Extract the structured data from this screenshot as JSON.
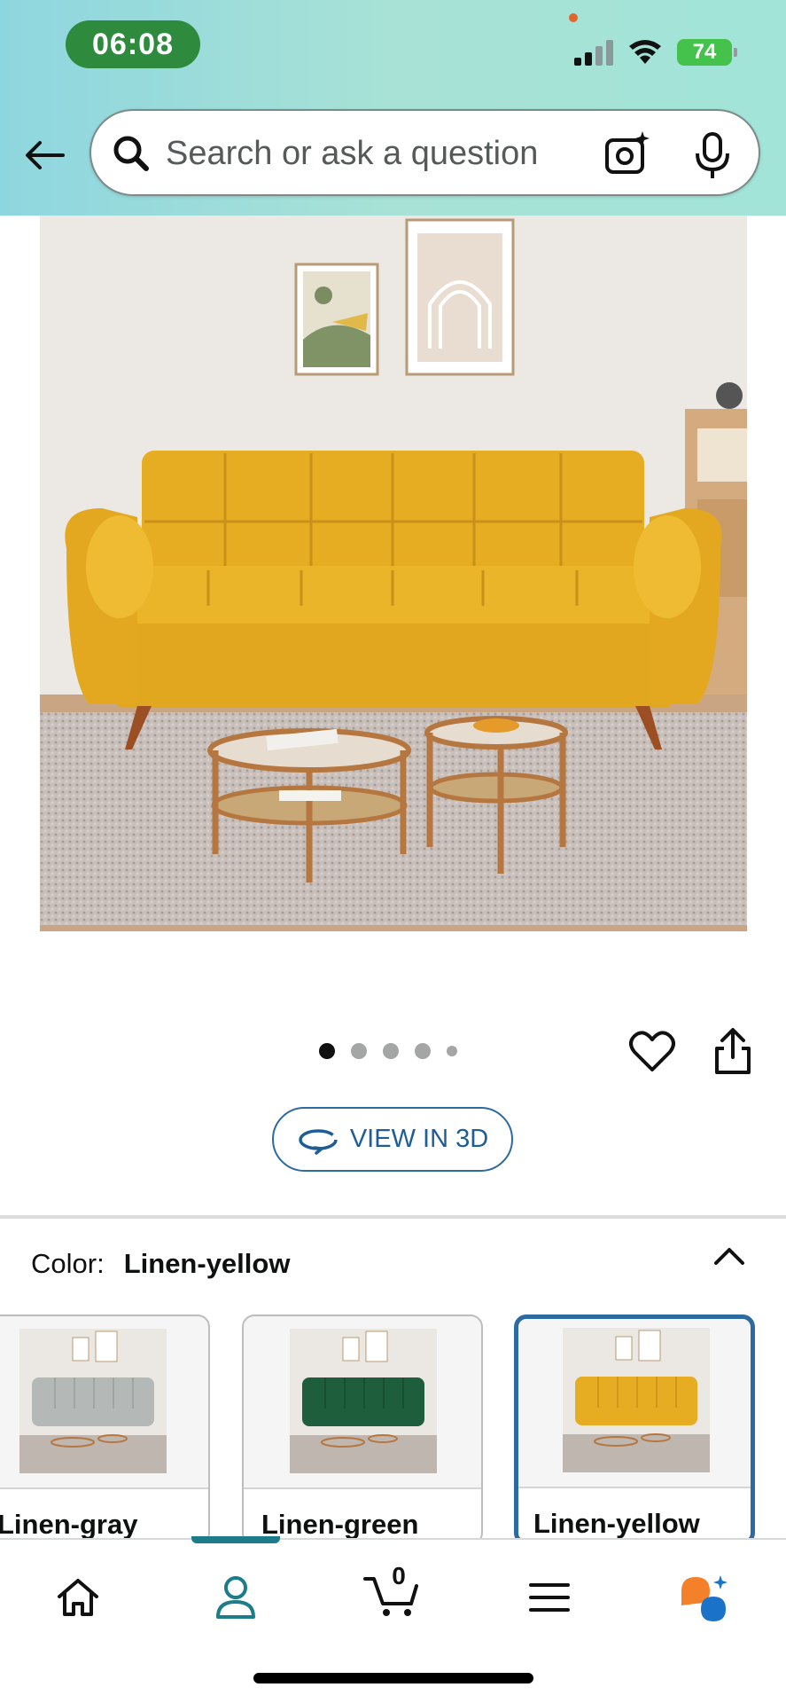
{
  "status_bar": {
    "time": "06:08",
    "battery": "74"
  },
  "search": {
    "placeholder": "Search or ask a question"
  },
  "carousel": {
    "total_images": 5,
    "active_index": 0
  },
  "view_in_3d": {
    "label": "VIEW IN 3D"
  },
  "color_selector": {
    "label": "Color:",
    "selected": "Linen-yellow",
    "options": [
      {
        "name": "Linen-gray",
        "sofa_color": "#b4b8b6"
      },
      {
        "name": "Linen-green",
        "sofa_color": "#1e5e3c"
      },
      {
        "name": "Linen-yellow",
        "sofa_color": "#e6ad22"
      }
    ]
  },
  "bottom_nav": {
    "items": [
      "home",
      "account",
      "cart",
      "menu",
      "rufus"
    ],
    "active": "account",
    "cart_count": "0"
  },
  "colors": {
    "header_gradient_start": "#8ed6df",
    "header_gradient_end": "#a2e4d8",
    "accent_blue": "#2b6aa3",
    "nav_active": "#1d7c8a",
    "sofa_yellow": "#e6ad22"
  }
}
